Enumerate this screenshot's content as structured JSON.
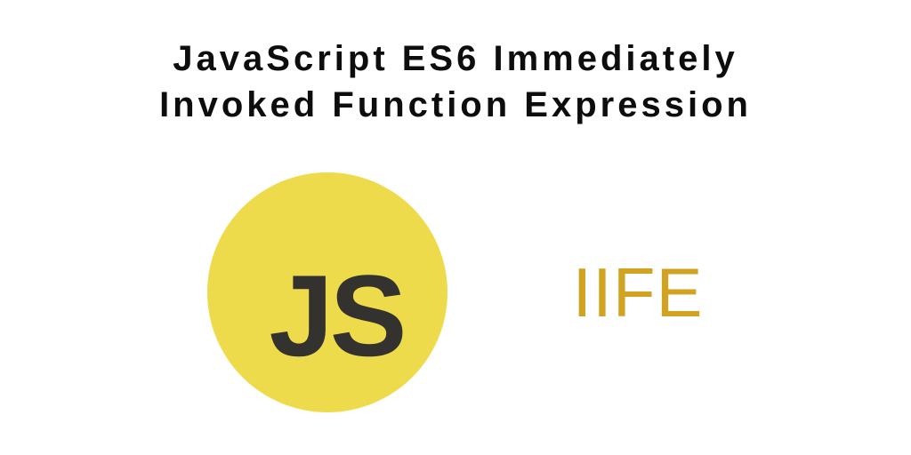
{
  "header": {
    "title_line1": "JavaScript ES6 Immediately",
    "title_line2": "Invoked Function Expression"
  },
  "badge": {
    "label": "JS",
    "bg_color": "#eedb4c",
    "text_color": "#34322e"
  },
  "acronym": {
    "text": "IIFE",
    "color": "#d1a320"
  }
}
